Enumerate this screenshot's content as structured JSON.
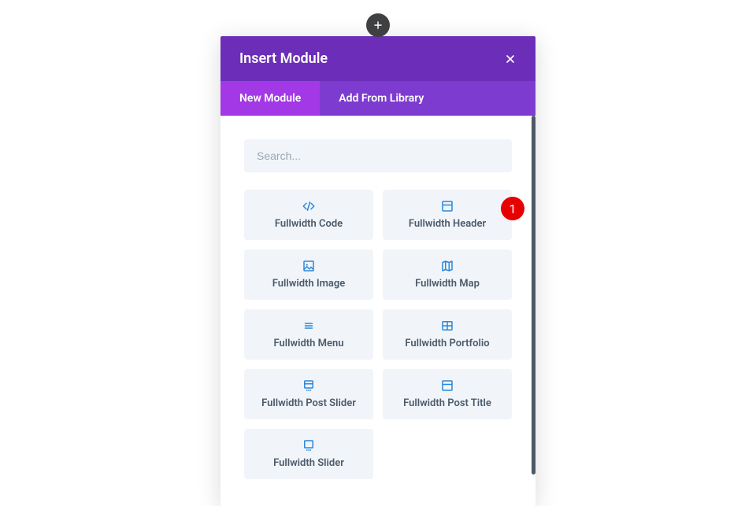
{
  "addButton": {
    "tooltip": "Add"
  },
  "modal": {
    "title": "Insert Module",
    "close": "Close"
  },
  "tabs": {
    "new": "New Module",
    "library": "Add From Library"
  },
  "search": {
    "placeholder": "Search..."
  },
  "modules": [
    {
      "label": "Fullwidth Code",
      "icon": "code"
    },
    {
      "label": "Fullwidth Header",
      "icon": "header",
      "callout": "1"
    },
    {
      "label": "Fullwidth Image",
      "icon": "image"
    },
    {
      "label": "Fullwidth Map",
      "icon": "map"
    },
    {
      "label": "Fullwidth Menu",
      "icon": "menu"
    },
    {
      "label": "Fullwidth Portfolio",
      "icon": "portfolio"
    },
    {
      "label": "Fullwidth Post Slider",
      "icon": "post-slider"
    },
    {
      "label": "Fullwidth Post Title",
      "icon": "post-title"
    },
    {
      "label": "Fullwidth Slider",
      "icon": "slider"
    }
  ],
  "colors": {
    "iconBlue": "#2b87da"
  }
}
